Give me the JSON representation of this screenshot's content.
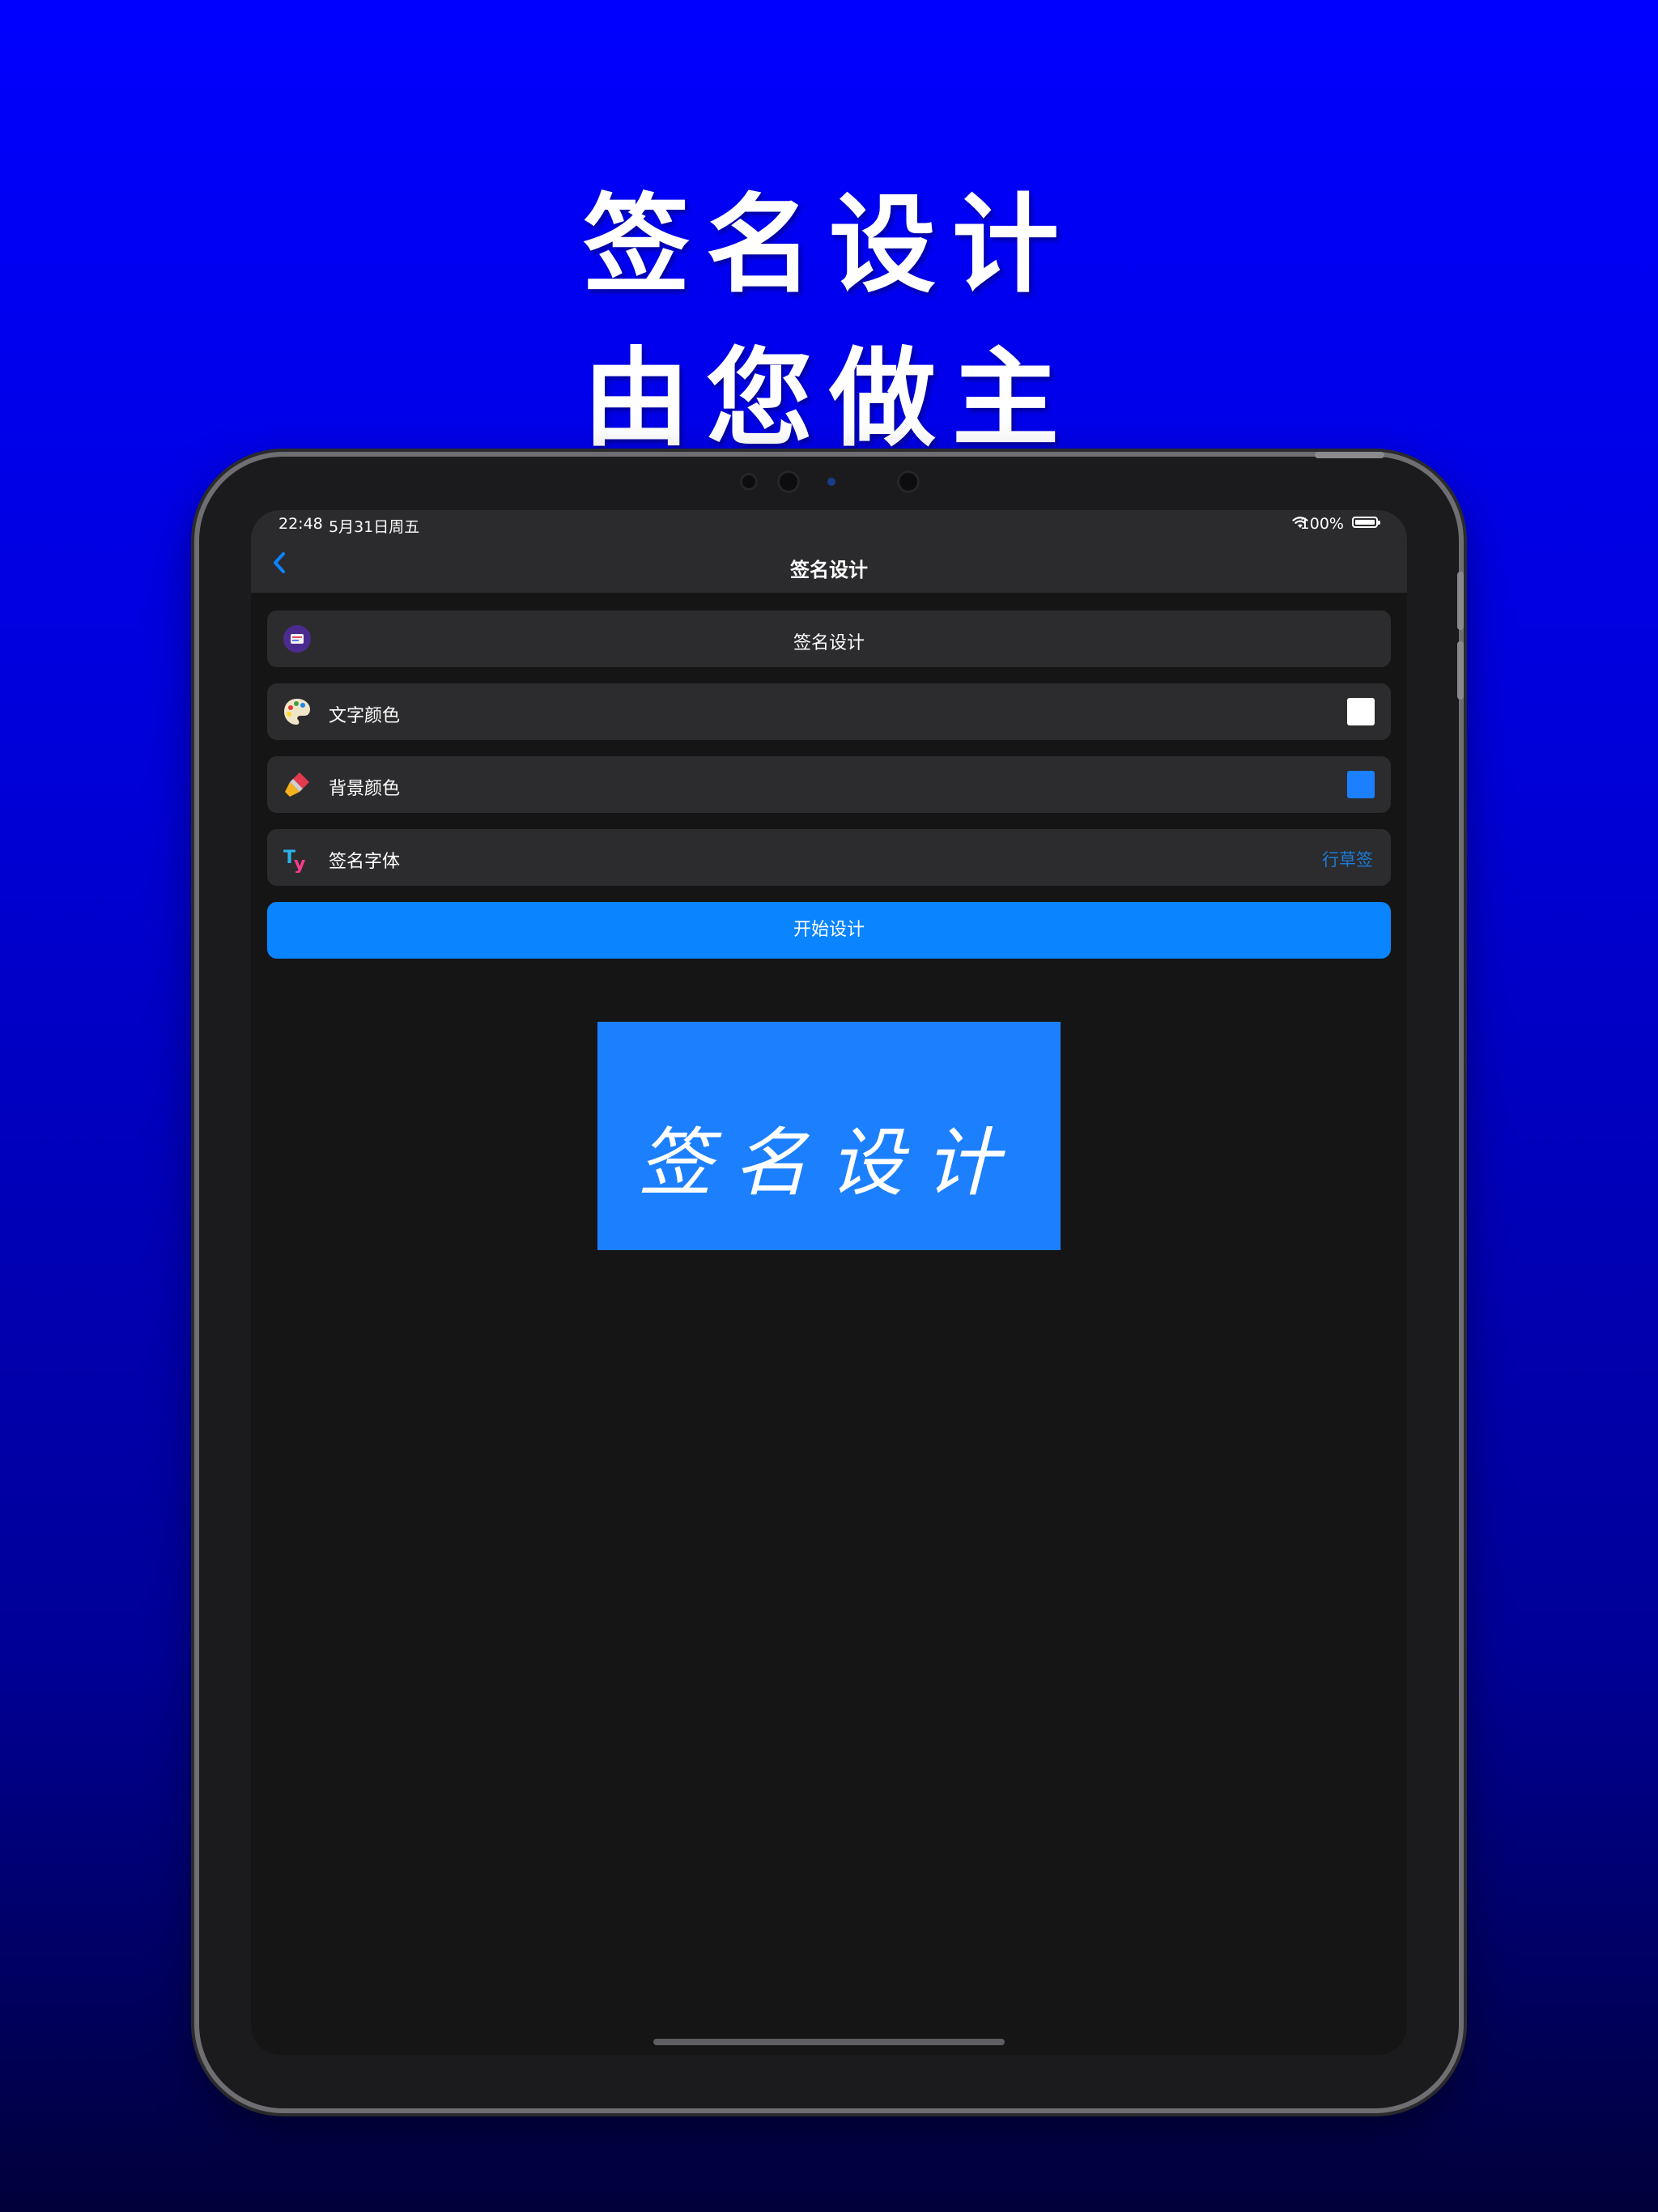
{
  "promo": {
    "headline_line1": "签名设计",
    "headline_line2": "由您做主"
  },
  "status_bar": {
    "time": "22:48",
    "date": "5月31日周五",
    "battery": "100%"
  },
  "nav": {
    "title": "签名设计"
  },
  "settings": {
    "header_row_label": "签名设计",
    "text_color_label": "文字颜色",
    "text_color_value": "#ffffff",
    "bg_color_label": "背景颜色",
    "bg_color_value": "#1b7ffe",
    "font_label": "签名字体",
    "font_value": "行草签"
  },
  "actions": {
    "start_label": "开始设计"
  },
  "preview": {
    "signature_text": "签名设计",
    "background": "#1b7ffe",
    "text_color": "#ffffff"
  },
  "colors": {
    "accent": "#0a84ff",
    "row_bg": "#2c2c2e",
    "screen_bg": "#151515"
  },
  "icons": {
    "back": "chevron-left-icon",
    "header_row": "app-icon",
    "text_color": "palette-icon",
    "bg_color": "brush-icon",
    "font": "font-icon"
  }
}
